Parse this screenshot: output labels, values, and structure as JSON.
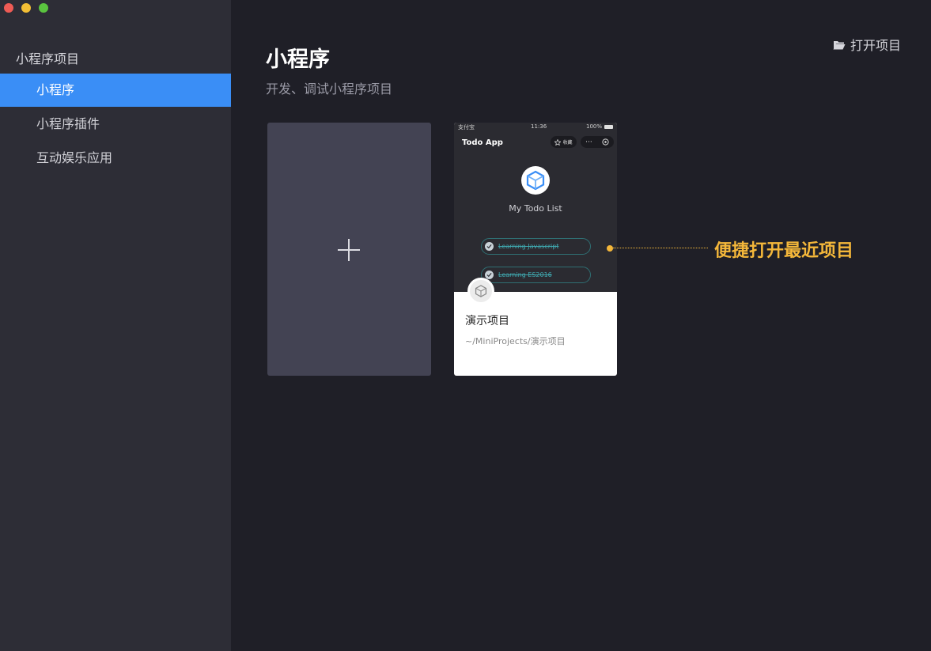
{
  "sidebar": {
    "title": "小程序项目",
    "items": [
      {
        "label": "小程序",
        "active": true
      },
      {
        "label": "小程序插件",
        "active": false
      },
      {
        "label": "互动娱乐应用",
        "active": false
      }
    ]
  },
  "header": {
    "title": "小程序",
    "subtitle": "开发、调试小程序项目",
    "open_project_label": "打开项目",
    "open_project_icon": "folder-open-icon"
  },
  "new_project": {
    "icon": "plus-icon"
  },
  "project_card": {
    "name": "演示项目",
    "path": "~/MiniProjects/演示项目",
    "preview": {
      "status_left": "支付宝",
      "status_time": "11:36",
      "status_battery": "100%",
      "app_title": "Todo App",
      "fav_label": "收藏",
      "more_glyph": "···",
      "heading": "My Todo List",
      "todos": [
        "Learning Javascript",
        "Learning ES2016"
      ]
    }
  },
  "callout": {
    "text": "便捷打开最近项目",
    "color": "#f4b73a"
  },
  "colors": {
    "accent": "#3a8ef6",
    "sidebar_bg": "#2d2d36",
    "main_bg": "#1f1f27",
    "card_bg": "#434353"
  }
}
